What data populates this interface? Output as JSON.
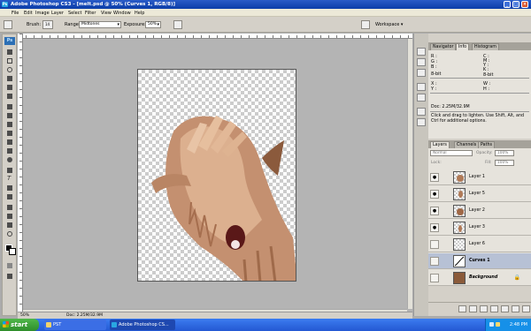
{
  "titlebar": {
    "app_icon": "Ps",
    "title": "Adobe Photoshop CS3 - [melt.psd @ 50% (Curves 1, RGB/8)]",
    "buttons": {
      "minimize": "_",
      "maximize": "□",
      "close": "×"
    }
  },
  "menubar": {
    "items": [
      "File",
      "Edit",
      "Image",
      "Layer",
      "Select",
      "Filter",
      "View",
      "Window",
      "Help"
    ]
  },
  "options": {
    "brush_label": "Brush:",
    "brush_size": "14",
    "range_label": "Range:",
    "range_value": "Midtones",
    "exposure_label": "Exposure:",
    "exposure_value": "50%",
    "workspace_label": "Workspace ▾"
  },
  "toolbox": {
    "logo": "Ps"
  },
  "status": {
    "zoom": "50%",
    "doc": "Doc: 2.25M/32.9M"
  },
  "info_panel": {
    "tabs": [
      "Navigator",
      "Info",
      "Histogram"
    ],
    "active_tab": "Info",
    "fields": {
      "r": "R :",
      "g": "G :",
      "b": "B :",
      "c": "C :",
      "m": "M :",
      "y": "Y :",
      "k": "K :",
      "bit_left": "8-bit",
      "bit_right": "8-bit",
      "x": "X :",
      "yy": "Y :",
      "w": "W :",
      "h": "H :"
    },
    "doc": "Doc: 2.25M/32.9M",
    "hint": "Click and drag to lighten. Use Shift, Alt, and Ctrl for additional options."
  },
  "layers_panel": {
    "tabs": [
      "Layers",
      "Channels",
      "Paths"
    ],
    "active_tab": "Layers",
    "blend_mode": "Normal",
    "opacity_label": "Opacity:",
    "opacity_value": "100%",
    "lock_label": "Lock:",
    "fill_label": "Fill:",
    "fill_value": "100%",
    "layers": [
      {
        "name": "Layer 1",
        "visible": true
      },
      {
        "name": "Layer 5",
        "visible": true
      },
      {
        "name": "Layer 2",
        "visible": true
      },
      {
        "name": "Layer 3",
        "visible": true
      },
      {
        "name": "Layer 6",
        "visible": false
      },
      {
        "name": "Curves 1",
        "visible": false,
        "selected": true
      },
      {
        "name": "Background",
        "visible": false,
        "locked": true
      }
    ]
  },
  "taskbar": {
    "start": "start",
    "buttons": [
      "PST",
      "Adobe Photoshop CS..."
    ],
    "clock": "2:48 PM"
  }
}
